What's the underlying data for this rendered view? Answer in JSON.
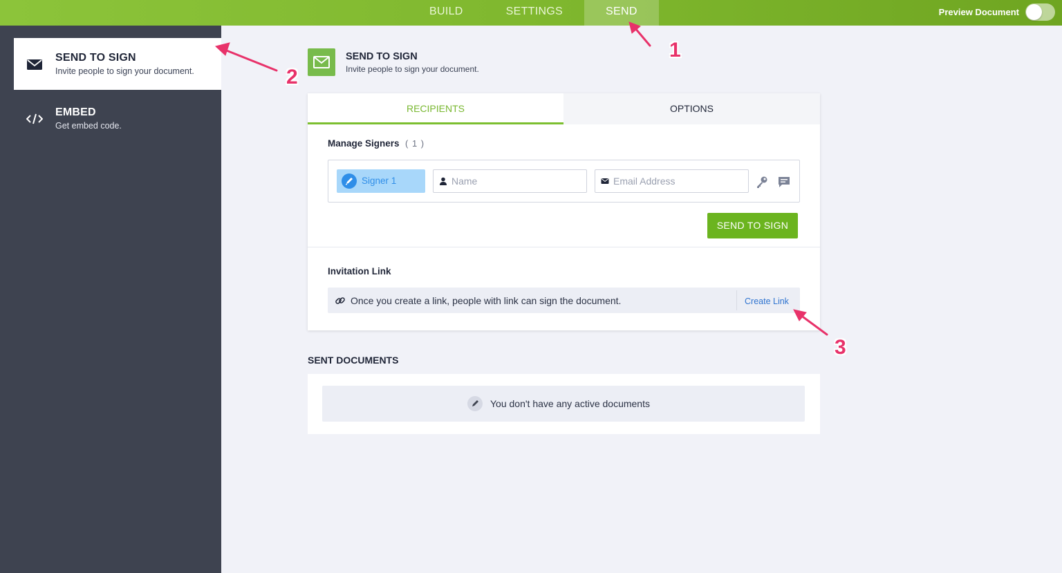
{
  "topbar": {
    "tabs": [
      {
        "label": "BUILD"
      },
      {
        "label": "SETTINGS"
      },
      {
        "label": "SEND"
      }
    ],
    "active_tab": "SEND",
    "preview_label": "Preview Document"
  },
  "sidebar": {
    "items": [
      {
        "title": "SEND TO SIGN",
        "subtitle": "Invite people to sign your document.",
        "icon": "envelope-icon"
      },
      {
        "title": "EMBED",
        "subtitle": "Get embed code.",
        "icon": "code-icon"
      }
    ]
  },
  "header": {
    "title": "SEND TO SIGN",
    "subtitle": "Invite people to sign your document.",
    "icon": "envelope-icon"
  },
  "card": {
    "tabs": [
      {
        "label": "RECIPIENTS"
      },
      {
        "label": "OPTIONS"
      }
    ],
    "active_tab": "RECIPIENTS",
    "manage_signers_label": "Manage Signers",
    "signer_count": "( 1 )",
    "signer": {
      "label": "Signer 1",
      "name_placeholder": "Name",
      "email_placeholder": "Email Address"
    },
    "send_button": "SEND TO SIGN",
    "invitation_link_label": "Invitation Link",
    "invitation_text": "Once you create a link, people with link can sign the document.",
    "create_link_label": "Create Link"
  },
  "sent_documents": {
    "title": "SENT DOCUMENTS",
    "empty_text": "You don't have any active documents"
  },
  "annotations": [
    "1",
    "2",
    "3"
  ],
  "colors": {
    "brand_green": "#7cbf2f",
    "button_green": "#6bb41f",
    "sidebar_dark": "#3e4350",
    "signer_blue": "#2f8ee8",
    "annotation_pink": "#e8326a"
  }
}
